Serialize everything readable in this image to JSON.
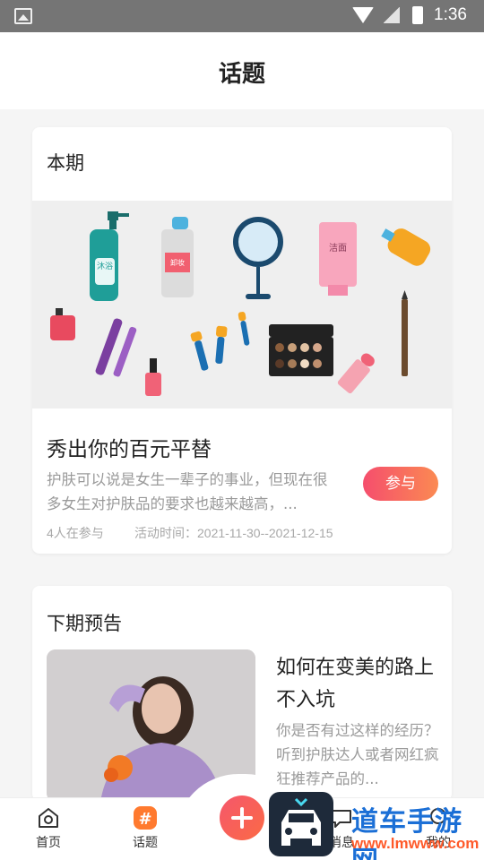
{
  "status_bar": {
    "time": "1:36"
  },
  "header": {
    "title": "话题"
  },
  "current": {
    "section_label": "本期",
    "banner_labels": {
      "wash": "沐浴",
      "remover": "卸妆",
      "cleanser": "洁面"
    },
    "topic_title": "秀出你的百元平替",
    "topic_desc": "护肤可以说是女生一辈子的事业，但现在很多女生对护肤品的要求也越来越高，...",
    "join_label": "参与",
    "participants": "4人在参与",
    "activity_time": "活动时间：2021-11-30--2021-12-15"
  },
  "next": {
    "section_label": "下期预告",
    "title": "如何在变美的路上不入坑",
    "desc": "你是否有过这样的经历？听到护肤达人或者网红疯狂推荐产品的..."
  },
  "tabbar": {
    "home_label": "首页",
    "topic_label": "话题",
    "msg_label": "消息",
    "me_label": "我的"
  },
  "watermark": {
    "text": "道车手游网",
    "url": "www.lmwww.com"
  },
  "colors": {
    "accent_start": "#f54e6d",
    "accent_end": "#fb8a52",
    "tab_active": "#ff7a2f"
  }
}
